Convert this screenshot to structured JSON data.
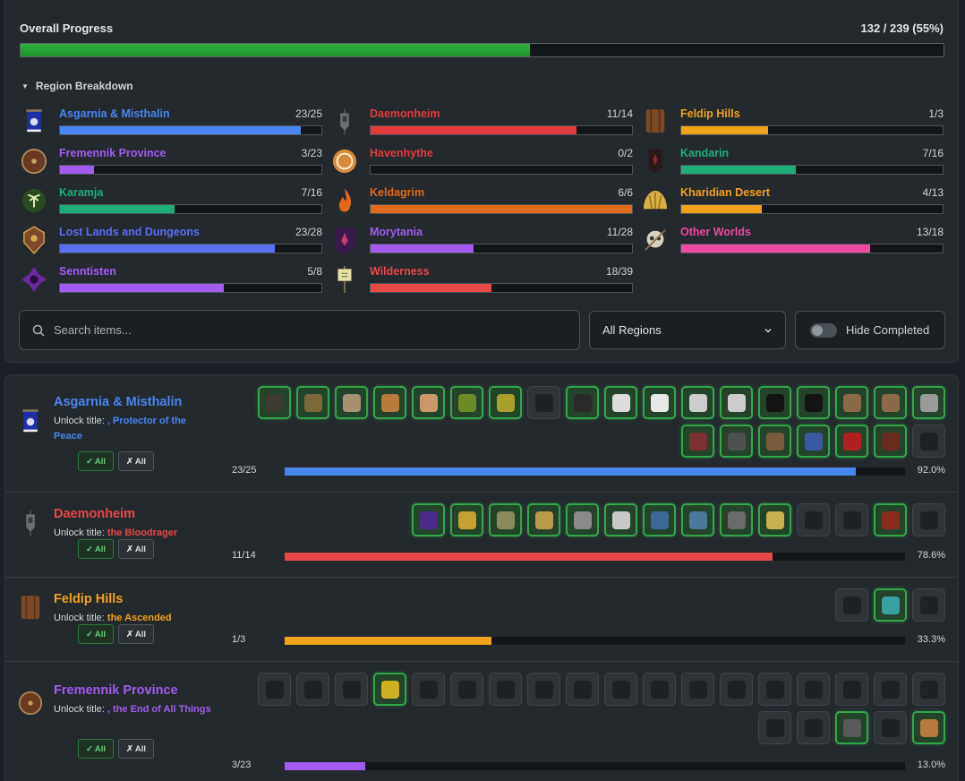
{
  "overall": {
    "label": "Overall Progress",
    "count": "132 / 239 (55%)",
    "fraction": 0.552,
    "bar_color": "#26a636"
  },
  "breakdown": {
    "label": "Region Breakdown",
    "caret": "▼"
  },
  "regions": [
    {
      "name": "Asgarnia & Misthalin",
      "count": "23/25",
      "fraction": 0.92,
      "color": "#4a86f0",
      "icon": "banner-icon"
    },
    {
      "name": "Daemonheim",
      "count": "11/14",
      "fraction": 0.786,
      "color": "#e03b3b",
      "icon": "lantern-icon"
    },
    {
      "name": "Feldip Hills",
      "count": "1/3",
      "fraction": 0.333,
      "color": "#f0a21b",
      "icon": "shield-icon"
    },
    {
      "name": "Fremennik Province",
      "count": "3/23",
      "fraction": 0.13,
      "color": "#a25cf0",
      "icon": "round-shield-icon"
    },
    {
      "name": "Havenhythe",
      "count": "0/2",
      "fraction": 0,
      "color": "#e03b3b",
      "icon": "knot-icon"
    },
    {
      "name": "Kandarin",
      "count": "7/16",
      "fraction": 0.438,
      "color": "#1fae78",
      "icon": "crest-icon"
    },
    {
      "name": "Karamja",
      "count": "7/16",
      "fraction": 0.438,
      "color": "#1fae78",
      "icon": "palm-icon"
    },
    {
      "name": "Keldagrim",
      "count": "6/6",
      "fraction": 1,
      "color": "#e06a1c",
      "icon": "flame-icon"
    },
    {
      "name": "Kharidian Desert",
      "count": "4/13",
      "fraction": 0.308,
      "color": "#f0a21b",
      "icon": "shell-icon"
    },
    {
      "name": "Lost Lands and Dungeons",
      "count": "23/28",
      "fraction": 0.821,
      "color": "#5b6ff0",
      "icon": "ornate-shield-icon"
    },
    {
      "name": "Morytania",
      "count": "11/28",
      "fraction": 0.393,
      "color": "#a25cf0",
      "icon": "dark-crest-icon"
    },
    {
      "name": "Other Worlds",
      "count": "13/18",
      "fraction": 0.722,
      "color": "#ee4aa0",
      "icon": "skull-icon"
    },
    {
      "name": "Senntisten",
      "count": "5/8",
      "fraction": 0.625,
      "color": "#a25cf0",
      "icon": "cross-emblem-icon"
    },
    {
      "name": "Wilderness",
      "count": "18/39",
      "fraction": 0.462,
      "color": "#e84848",
      "icon": "scroll-icon"
    }
  ],
  "region_name_colors": {
    "Asgarnia & Misthalin": "#4a86f0",
    "Daemonheim": "#e84848",
    "Feldip Hills": "#f0a21b",
    "Fremennik Province": "#a25cf0",
    "Havenhythe": "#e84848",
    "Kandarin": "#1fae78",
    "Karamja": "#1fae78",
    "Keldagrim": "#e06a1c",
    "Kharidian Desert": "#f0a21b",
    "Lost Lands and Dungeons": "#5b6ff0",
    "Morytania": "#a25cf0",
    "Other Worlds": "#ee4aa0",
    "Senntisten": "#a25cf0",
    "Wilderness": "#e84848"
  },
  "search": {
    "placeholder": "Search items..."
  },
  "region_select": {
    "value": "All Regions"
  },
  "hide_completed": {
    "label": "Hide Completed",
    "on": false
  },
  "buttons": {
    "check_all": "All",
    "uncheck_all": "All",
    "check_glyph": "✓",
    "x_glyph": "✗"
  },
  "sections": [
    {
      "name": "Asgarnia & Misthalin",
      "color": "#4a86f0",
      "unlock_prefix": "Unlock title: ",
      "unlock_title": ", Protector of the Peace",
      "count": "23/25",
      "fraction": 0.92,
      "pct": "92.0%",
      "icon": "banner-icon",
      "items": [
        1,
        1,
        1,
        1,
        1,
        1,
        1,
        0,
        1,
        1,
        1,
        1,
        1,
        1,
        1,
        1,
        1,
        1,
        1,
        1,
        1,
        1,
        1,
        1,
        0
      ],
      "item_colors": [
        "#3b3b33",
        "#7a6a3a",
        "#a89070",
        "#b87a3a",
        "#c8986a",
        "#6c8a28",
        "#a8a02a",
        "#555555",
        "#2a2a2a",
        "#dcdcdc",
        "#e8e8e8",
        "#cccccc",
        "#cccccc",
        "#141414",
        "#141414",
        "#8a6a4a",
        "#8a6a4a",
        "#9a9a9a",
        "#7a3030",
        "#505050",
        "#7a5a3a",
        "#3a5aa0",
        "#b02020",
        "#6a2a20",
        "#555555"
      ]
    },
    {
      "name": "Daemonheim",
      "color": "#e84848",
      "unlock_prefix": "Unlock title: ",
      "unlock_title": "the Bloodrager",
      "count": "11/14",
      "fraction": 0.786,
      "pct": "78.6%",
      "icon": "lantern-icon",
      "items": [
        1,
        1,
        1,
        1,
        1,
        1,
        1,
        1,
        1,
        1,
        0,
        0,
        1,
        0
      ],
      "item_colors": [
        "#4a2a8a",
        "#c8a030",
        "#8a8a5a",
        "#b89a4a",
        "#8a8a8a",
        "#c8c8c8",
        "#3a6a9a",
        "#4a7a9a",
        "#6a6a6a",
        "#c8b050",
        "#555555",
        "#555555",
        "#8a2a1a",
        "#555555"
      ]
    },
    {
      "name": "Feldip Hills",
      "color": "#f0a21b",
      "unlock_prefix": "Unlock title: ",
      "unlock_title": "the Ascended",
      "count": "1/3",
      "fraction": 0.333,
      "pct": "33.3%",
      "icon": "shield-icon",
      "items": [
        0,
        1,
        0
      ],
      "item_colors": [
        "#555555",
        "#3aa0a0",
        "#555555"
      ]
    },
    {
      "name": "Fremennik Province",
      "color": "#a25cf0",
      "unlock_prefix": "Unlock title: ",
      "unlock_title": ", the End of All Things",
      "count": "3/23",
      "fraction": 0.13,
      "pct": "13.0%",
      "icon": "round-shield-icon",
      "items": [
        0,
        0,
        0,
        1,
        0,
        0,
        0,
        0,
        0,
        0,
        0,
        0,
        0,
        0,
        0,
        0,
        0,
        0,
        0,
        0,
        1,
        0,
        1
      ],
      "item_colors": [
        "#555555",
        "#555555",
        "#555555",
        "#d0b020",
        "#555555",
        "#555555",
        "#555555",
        "#555555",
        "#555555",
        "#555555",
        "#555555",
        "#555555",
        "#555555",
        "#555555",
        "#555555",
        "#555555",
        "#555555",
        "#555555",
        "#555555",
        "#555555",
        "#5a5a5a",
        "#555555",
        "#b87a3a"
      ]
    }
  ]
}
